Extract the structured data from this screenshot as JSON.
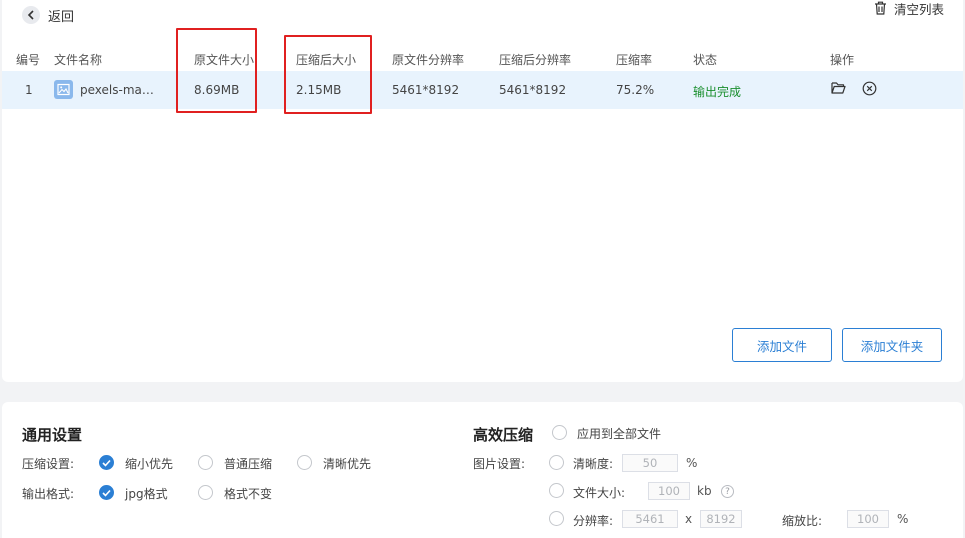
{
  "header": {
    "back_label": "返回",
    "clear_label": "清空列表"
  },
  "table": {
    "columns": [
      "编号",
      "文件名称",
      "原文件大小",
      "压缩后大小",
      "原文件分辨率",
      "压缩后分辨率",
      "压缩率",
      "状态",
      "操作"
    ],
    "rows": [
      {
        "index": "1",
        "name": "pexels-ma…",
        "original_size": "8.69MB",
        "compressed_size": "2.15MB",
        "original_resolution": "5461*8192",
        "compressed_resolution": "5461*8192",
        "ratio": "75.2%",
        "status": "输出完成"
      }
    ]
  },
  "actions": {
    "add_file": "添加文件",
    "add_folder": "添加文件夹"
  },
  "general": {
    "title": "通用设置",
    "compress_label": "压缩设置:",
    "compress_options": [
      "缩小优先",
      "普通压缩",
      "清晰优先"
    ],
    "compress_selected": "缩小优先",
    "format_label": "输出格式:",
    "format_options": [
      "jpg格式",
      "格式不变"
    ],
    "format_selected": "jpg格式"
  },
  "efficient": {
    "title": "高效压缩",
    "apply_all": "应用到全部文件",
    "image_label": "图片设置:",
    "clarity_label": "清晰度:",
    "clarity_value": "50",
    "clarity_unit": "%",
    "size_label": "文件大小:",
    "size_value": "100",
    "size_unit": "kb",
    "resolution_label": "分辨率:",
    "res_width": "5461",
    "res_sep": "x",
    "res_height": "8192",
    "scale_label": "缩放比:",
    "scale_value": "100",
    "scale_unit": "%"
  },
  "colors": {
    "accent": "#2b7fd4",
    "row_highlight": "#e8f3fd",
    "status_done": "#1a8f2e",
    "annotation_red": "#e02020"
  }
}
